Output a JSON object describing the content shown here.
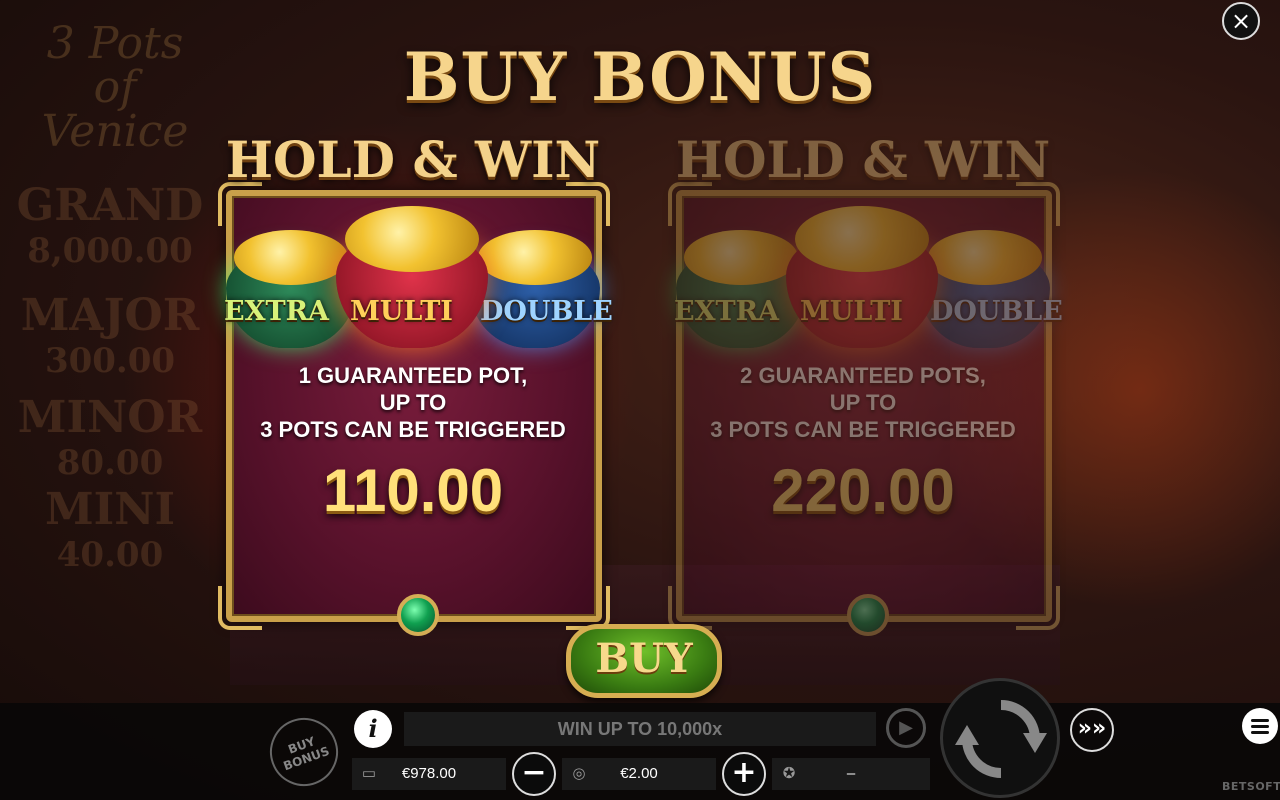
{
  "background": {
    "logo": "3 Pots of Venice",
    "jackpots": [
      {
        "name": "GRAND",
        "value": "8,000.00"
      },
      {
        "name": "MAJOR",
        "value": "300.00"
      },
      {
        "name": "MINOR",
        "value": "80.00"
      },
      {
        "name": "MINI",
        "value": "40.00"
      }
    ]
  },
  "modal": {
    "title": "BUY BONUS",
    "close_icon": "×",
    "options": [
      {
        "title": "HOLD & WIN",
        "pot_labels": [
          "EXTRA",
          "MULTI",
          "DOUBLE"
        ],
        "description_lines": [
          "1 GUARANTEED POT,",
          "UP TO",
          "3 POTS CAN BE TRIGGERED"
        ],
        "price": "110.00",
        "selected": true
      },
      {
        "title": "HOLD & WIN",
        "pot_labels": [
          "EXTRA",
          "MULTI",
          "DOUBLE"
        ],
        "description_lines": [
          "2 GUARANTEED POTS,",
          "UP TO",
          "3 POTS CAN BE TRIGGERED"
        ],
        "price": "220.00",
        "selected": false
      }
    ],
    "buy_label": "BUY"
  },
  "bottom_bar": {
    "buy_bonus_label": "BUY BONUS",
    "info_label": "i",
    "win_up_text": "WIN UP TO 10,000x",
    "balance": "€978.00",
    "bet": "€2.00",
    "win": "–",
    "minus_label": "−",
    "plus_label": "+",
    "turbo_label": "»»",
    "provider": "BETSOFT"
  },
  "colors": {
    "gold": "#f6d58c",
    "card_bg": "#5a122c",
    "buy_green": "#3a7c12"
  }
}
